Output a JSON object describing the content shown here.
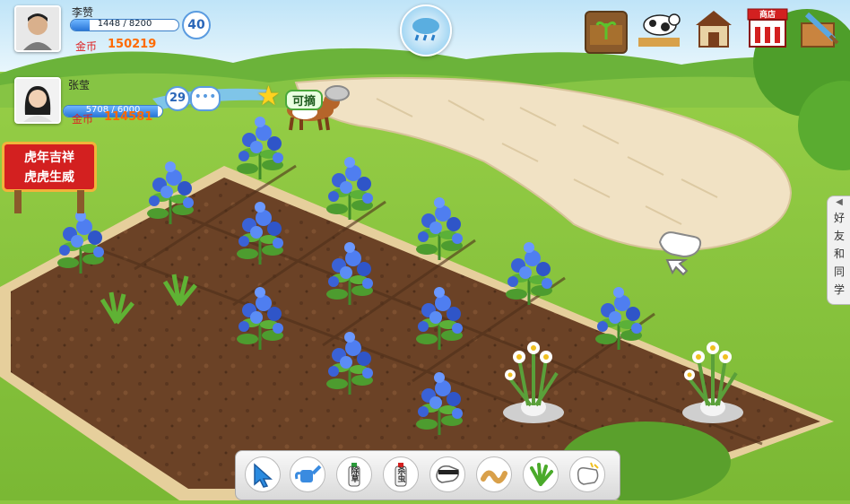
{
  "players": [
    {
      "name": "李赞",
      "xp": "1448 / 8200",
      "xp_fraction": 0.177,
      "level": "40",
      "coin_label": "金币",
      "coins": "150219"
    },
    {
      "name": "张莹",
      "xp": "5708 / 6000",
      "xp_fraction": 0.951,
      "level": "29",
      "coin_label": "金币",
      "coins": "114581"
    }
  ],
  "banner": {
    "line1": "虎年吉祥",
    "line2": "虎虎生威"
  },
  "pet_badge": "可摘",
  "shop_sign": "商店",
  "side_tab": {
    "chars": [
      "好",
      "友",
      "和",
      "同",
      "学"
    ]
  },
  "tools": [
    {
      "icon": "pointer-icon",
      "label": ""
    },
    {
      "icon": "watering-can-icon",
      "label": ""
    },
    {
      "icon": "herbicide-bottle-icon",
      "label": "除草"
    },
    {
      "icon": "pesticide-bottle-icon",
      "label": "杀虫"
    },
    {
      "icon": "thief-glove-icon",
      "label": ""
    },
    {
      "icon": "worm-icon",
      "label": ""
    },
    {
      "icon": "grass-icon",
      "label": ""
    },
    {
      "icon": "harvest-hand-icon",
      "label": ""
    }
  ],
  "colors": {
    "grass": "#8cc63f",
    "soil": "#6b4226",
    "sky": "#cfe9f7",
    "coin": "#ff6a00",
    "xp": "#2a77d8"
  }
}
